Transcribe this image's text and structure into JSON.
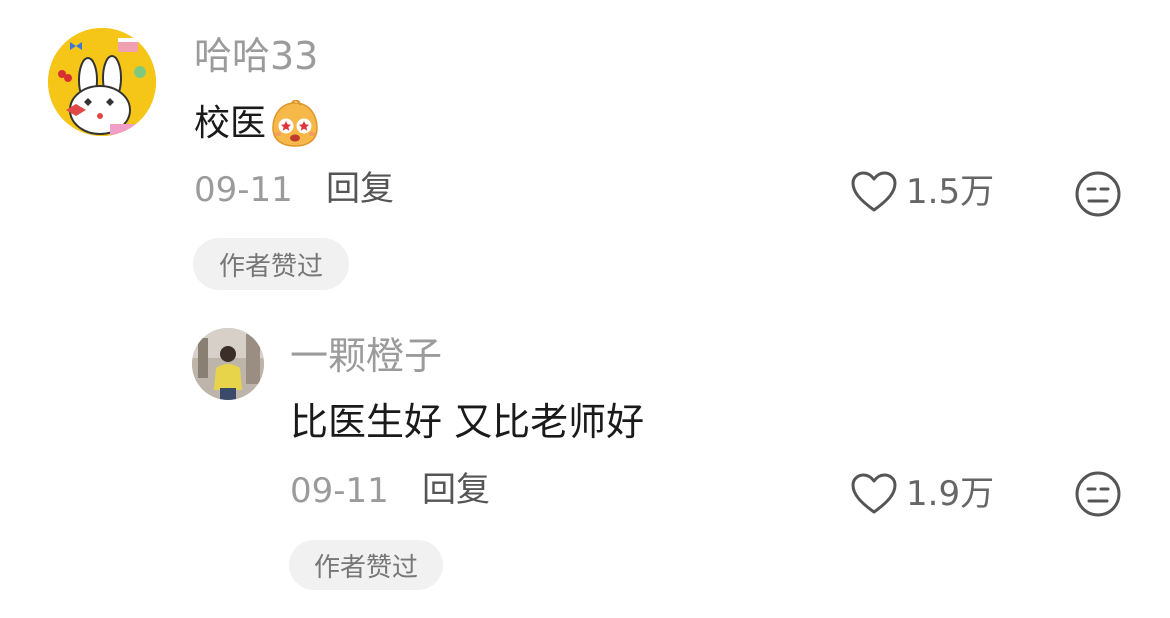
{
  "comments": [
    {
      "username": "哈哈33",
      "text": "校医",
      "emoji": "excited-face-emoji",
      "date": "09-11",
      "reply_label": "回复",
      "likes": "1.5万",
      "badge": "作者赞过"
    },
    {
      "username": "一颗橙子",
      "text": "比医生好 又比老师好",
      "date": "09-11",
      "reply_label": "回复",
      "likes": "1.9万",
      "badge": "作者赞过"
    }
  ],
  "colors": {
    "username": "#9b9b9b",
    "badge_bg": "#f1f1f1",
    "avatar1_bg": "#f5c518"
  }
}
